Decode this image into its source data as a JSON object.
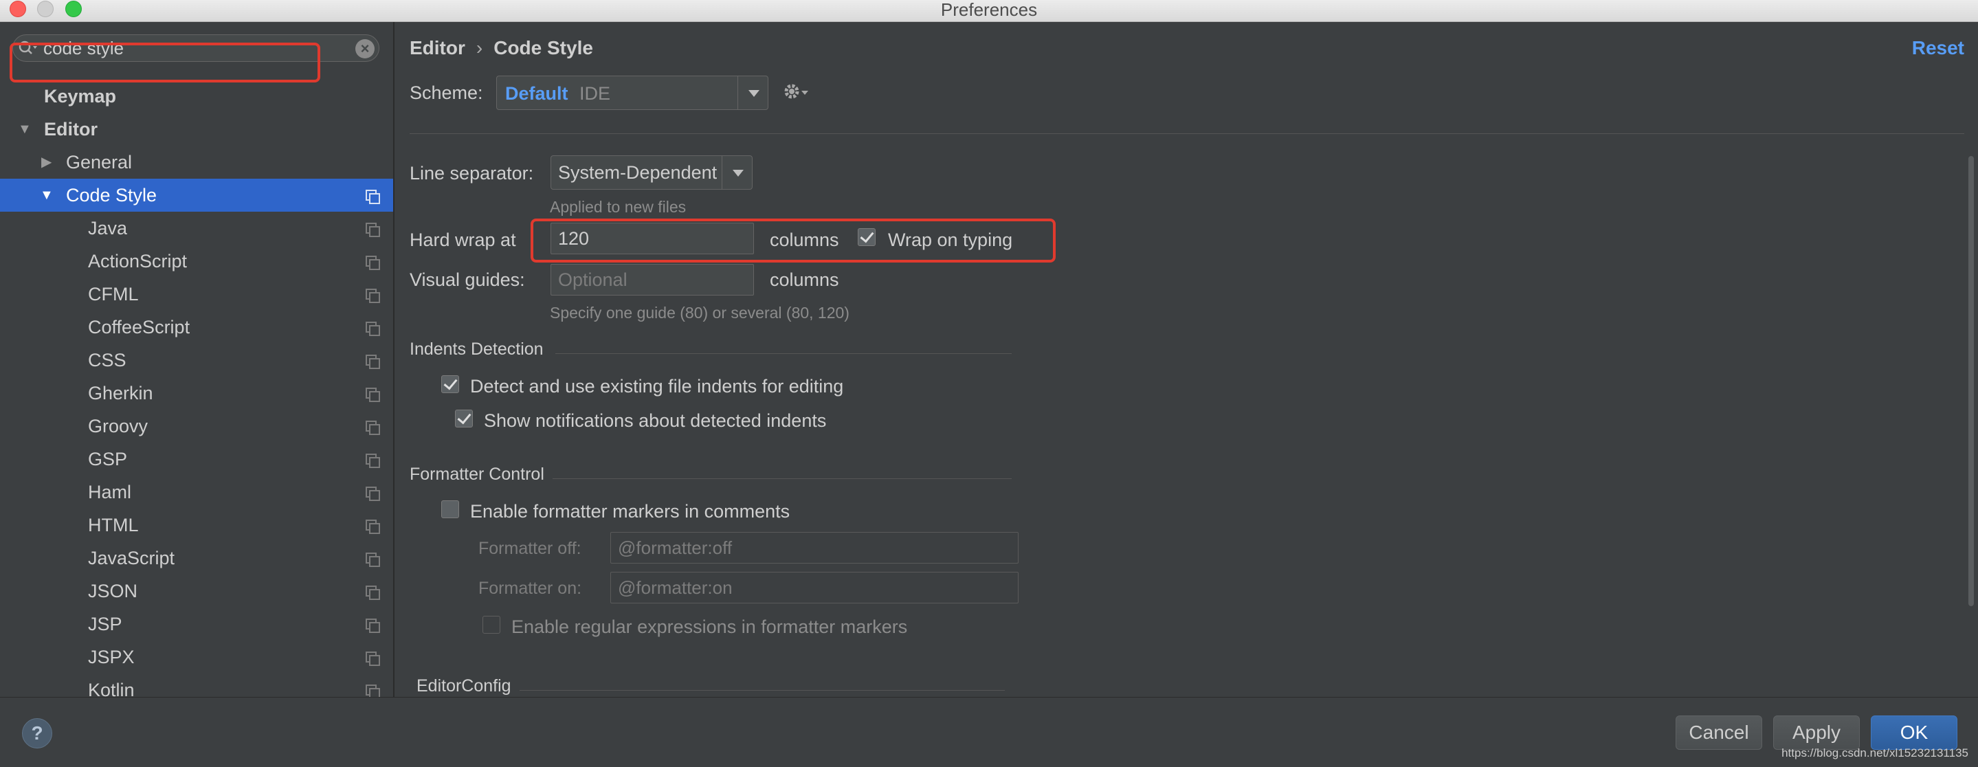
{
  "window": {
    "title": "Preferences"
  },
  "search": {
    "value": "code style"
  },
  "tree": {
    "keymap": "Keymap",
    "editor": "Editor",
    "general": "General",
    "code_style": "Code Style",
    "languages": [
      "Java",
      "ActionScript",
      "CFML",
      "CoffeeScript",
      "CSS",
      "Gherkin",
      "Groovy",
      "GSP",
      "Haml",
      "HTML",
      "JavaScript",
      "JSON",
      "JSP",
      "JSPX",
      "Kotlin"
    ]
  },
  "header": {
    "crumb_parent": "Editor",
    "crumb_sep": "›",
    "crumb_current": "Code Style",
    "reset": "Reset"
  },
  "scheme": {
    "label": "Scheme:",
    "name": "Default",
    "sub": "IDE"
  },
  "line_separator": {
    "label": "Line separator:",
    "value": "System-Dependent",
    "hint": "Applied to new files"
  },
  "hard_wrap": {
    "label": "Hard wrap at",
    "value": "120",
    "suffix": "columns",
    "wrap_on_typing": "Wrap on typing",
    "wrap_checked": true
  },
  "visual_guides": {
    "label": "Visual guides:",
    "placeholder": "Optional",
    "suffix": "columns",
    "hint": "Specify one guide (80) or several (80, 120)"
  },
  "indents": {
    "title": "Indents Detection",
    "detect": "Detect and use existing file indents for editing",
    "notify": "Show notifications about detected indents"
  },
  "formatter": {
    "title": "Formatter Control",
    "enable": "Enable formatter markers in comments",
    "off_label": "Formatter off:",
    "off_value": "@formatter:off",
    "on_label": "Formatter on:",
    "on_value": "@formatter:on",
    "regex": "Enable regular expressions in formatter markers"
  },
  "editorconfig": {
    "title": "EditorConfig"
  },
  "footer": {
    "help": "?",
    "cancel": "Cancel",
    "apply": "Apply",
    "ok": "OK"
  },
  "watermark": "https://blog.csdn.net/xl15232131135",
  "colors": {
    "accent": "#2f65ca",
    "link": "#589df6",
    "highlight_box": "#e03a2e",
    "background": "#3c3f41"
  }
}
